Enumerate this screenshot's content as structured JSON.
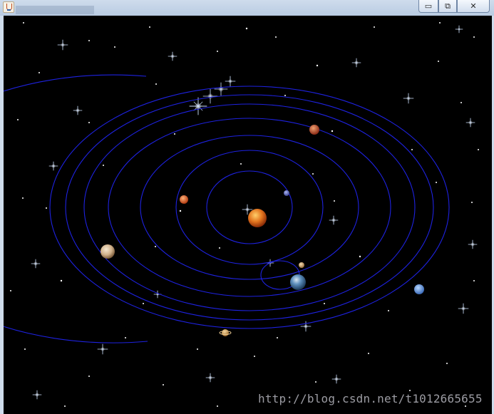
{
  "window": {
    "minimize_glyph": "▭",
    "maximize_glyph": "⧉",
    "close_glyph": "✕"
  },
  "watermark": "http://blog.csdn.net/t1012665655",
  "colors": {
    "space": "#000000",
    "orbit": "#1e22e0",
    "sun": "#e2741e",
    "mercury": "#6673c8",
    "venus": "#e06a2a",
    "earth": "#4a78a8",
    "moon": "#d2b48c",
    "mars": "#c8502e",
    "jupiter": "#d8c2a0",
    "saturn": "#d8a060",
    "uranus": "#5e96e0"
  },
  "icons": [
    "java-app-icon",
    "minimize-icon",
    "maximize-icon",
    "close-icon"
  ]
}
